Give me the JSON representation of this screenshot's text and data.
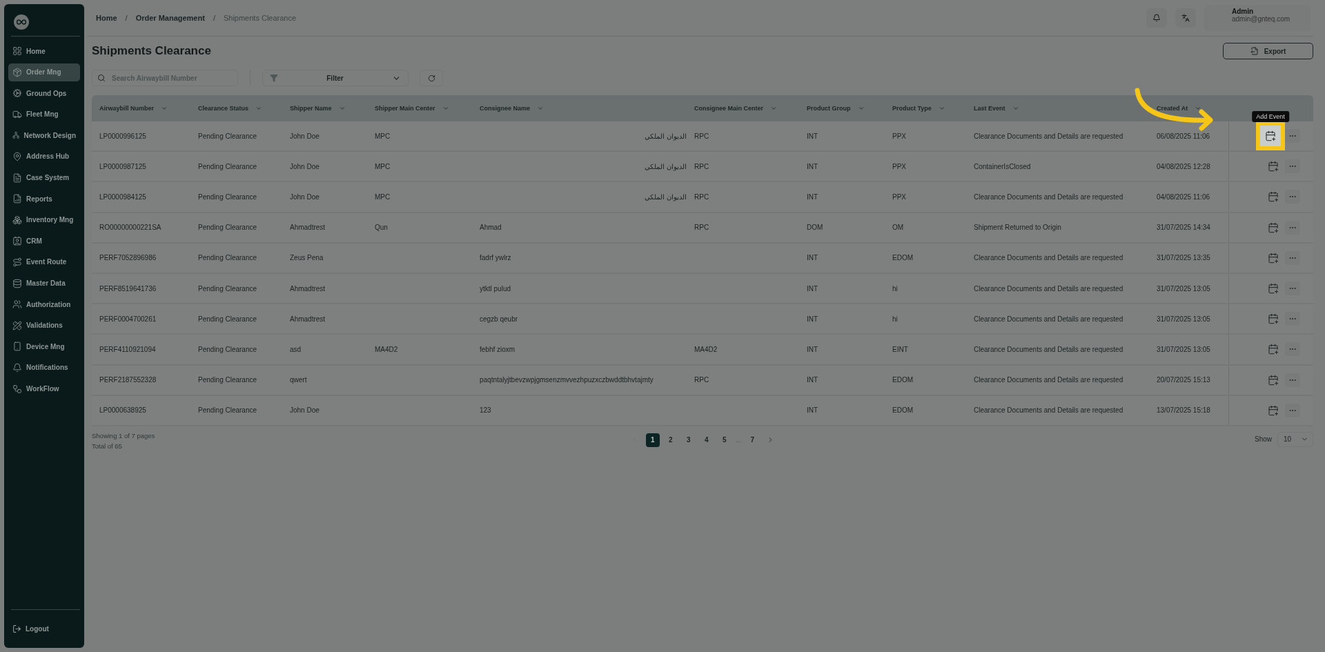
{
  "sidebar": {
    "items": [
      {
        "label": "Home",
        "selected": false
      },
      {
        "label": "Order Mng",
        "selected": true
      },
      {
        "label": "Ground Ops",
        "selected": false
      },
      {
        "label": "Fleet Mng",
        "selected": false
      },
      {
        "label": "Network Design",
        "selected": false
      },
      {
        "label": "Address Hub",
        "selected": false
      },
      {
        "label": "Case System",
        "selected": false
      },
      {
        "label": "Reports",
        "selected": false
      },
      {
        "label": "Inventory Mng",
        "selected": false
      },
      {
        "label": "CRM",
        "selected": false
      },
      {
        "label": "Event Route",
        "selected": false
      },
      {
        "label": "Master Data",
        "selected": false
      },
      {
        "label": "Authorization",
        "selected": false
      },
      {
        "label": "Validations",
        "selected": false
      },
      {
        "label": "Device Mng",
        "selected": false
      },
      {
        "label": "Notifications",
        "selected": false
      },
      {
        "label": "WorkFlow",
        "selected": false
      }
    ],
    "logout": "Logout"
  },
  "breadcrumb": {
    "separator": "/",
    "items": [
      "Home",
      "Order Management",
      "Shipments Clearance"
    ]
  },
  "user": {
    "name": "Admin",
    "email": "admin@gnteq.com"
  },
  "page_title": "Shipments Clearance",
  "export_button": "Export",
  "search": {
    "placeholder": "Search Airwaybill Number"
  },
  "filter": {
    "label": "Filter"
  },
  "table": {
    "columns": [
      "Airwaybill Number",
      "Clearance Status",
      "Shipper Name",
      "Shipper Main Center",
      "Consignee Name",
      "Consignee Main Center",
      "Product Group",
      "Product Type",
      "Last Event",
      "Created At"
    ],
    "rows": [
      {
        "cells": [
          "LP0000996125",
          "Pending Clearance",
          "John Doe",
          "MPC",
          "الديوان الملكي",
          "RPC",
          "INT",
          "PPX",
          "Clearance Documents and Details are requested",
          "06/08/2025 11:06"
        ],
        "highlighted": true
      },
      {
        "cells": [
          "LP0000987125",
          "Pending Clearance",
          "John Doe",
          "MPC",
          "الديوان الملكي",
          "RPC",
          "INT",
          "PPX",
          "ContainerIsClosed",
          "04/08/2025 12:28"
        ],
        "highlighted": false
      },
      {
        "cells": [
          "LP0000984125",
          "Pending Clearance",
          "John Doe",
          "MPC",
          "الديوان الملكي",
          "RPC",
          "INT",
          "PPX",
          "Clearance Documents and Details are requested",
          "04/08/2025 11:06"
        ],
        "highlighted": false
      },
      {
        "cells": [
          "RO00000000221SA",
          "Pending Clearance",
          "Ahmadtrest",
          "Qun",
          "Ahmad",
          "RPC",
          "DOM",
          "OM",
          "Shipment Returned to Origin",
          "31/07/2025 14:34"
        ],
        "highlighted": false
      },
      {
        "cells": [
          "PERF7052896986",
          "Pending Clearance",
          "Zeus Pena",
          "",
          "fadrf ywlrz",
          "",
          "INT",
          "EDOM",
          "Clearance Documents and Details are requested",
          "31/07/2025 13:35"
        ],
        "highlighted": false
      },
      {
        "cells": [
          "PERF8519641736",
          "Pending Clearance",
          "Ahmadtrest",
          "",
          "ytktl pulud",
          "",
          "INT",
          "hi",
          "Clearance Documents and Details are requested",
          "31/07/2025 13:05"
        ],
        "highlighted": false
      },
      {
        "cells": [
          "PERF0004700261",
          "Pending Clearance",
          "Ahmadtrest",
          "",
          "cegzb qeubr",
          "",
          "INT",
          "hi",
          "Clearance Documents and Details are requested",
          "31/07/2025 13:05"
        ],
        "highlighted": false
      },
      {
        "cells": [
          "PERF4110921094",
          "Pending Clearance",
          "asd",
          "MA4D2",
          "febhf zioxm",
          "MA4D2",
          "INT",
          "EINT",
          "Clearance Documents and Details are requested",
          "31/07/2025 13:05"
        ],
        "highlighted": false
      },
      {
        "cells": [
          "PERF2187552328",
          "Pending Clearance",
          "qwert",
          "",
          "paqtntalyjtbevzwpjgmsenzmvvezhpuzxczbwddtbhvtajmty",
          "RPC",
          "INT",
          "EDOM",
          "Clearance Documents and Details are requested",
          "20/07/2025 15:13"
        ],
        "highlighted": false
      },
      {
        "cells": [
          "LP0000638925",
          "Pending Clearance",
          "John Doe",
          "",
          "123",
          "",
          "INT",
          "EDOM",
          "Clearance Documents and Details are requested",
          "13/07/2025 15:18"
        ],
        "highlighted": false
      }
    ]
  },
  "tooltip": "Add Event",
  "footer": {
    "showing": "Showing 1 of 7 pages",
    "total": "Total of 65"
  },
  "pagination": {
    "prev_disabled": true,
    "next_disabled": false,
    "pages": [
      {
        "label": "1",
        "selected": true,
        "kind": "page"
      },
      {
        "label": "2",
        "selected": false,
        "kind": "page"
      },
      {
        "label": "3",
        "selected": false,
        "kind": "page"
      },
      {
        "label": "4",
        "selected": false,
        "kind": "page"
      },
      {
        "label": "5",
        "selected": false,
        "kind": "page"
      },
      {
        "label": "...",
        "kind": "ellipsis"
      },
      {
        "label": "7",
        "selected": false,
        "kind": "page"
      }
    ]
  },
  "page_size": {
    "label": "Show",
    "value": "10"
  }
}
